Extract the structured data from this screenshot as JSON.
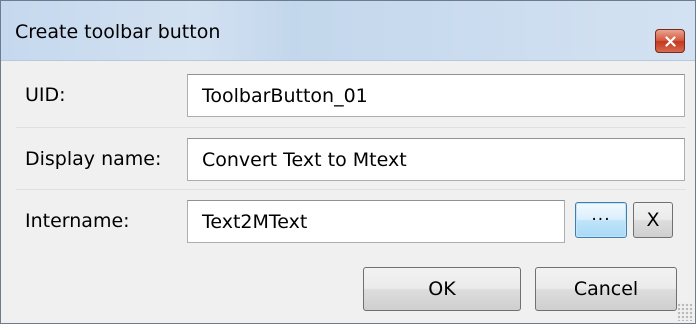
{
  "window": {
    "title": "Create toolbar button",
    "close_label": "x"
  },
  "form": {
    "uid": {
      "label": "UID:",
      "value": "ToolbarButton_01"
    },
    "display_name": {
      "label": "Display name:",
      "value": "Convert Text to Mtext"
    },
    "intername": {
      "label": "Intername:",
      "value": "Text2MText",
      "browse_label": "...",
      "clear_label": "X"
    }
  },
  "buttons": {
    "ok": "OK",
    "cancel": "Cancel"
  },
  "icons": {
    "close": "close-icon",
    "resize": "resize-grip-icon"
  }
}
